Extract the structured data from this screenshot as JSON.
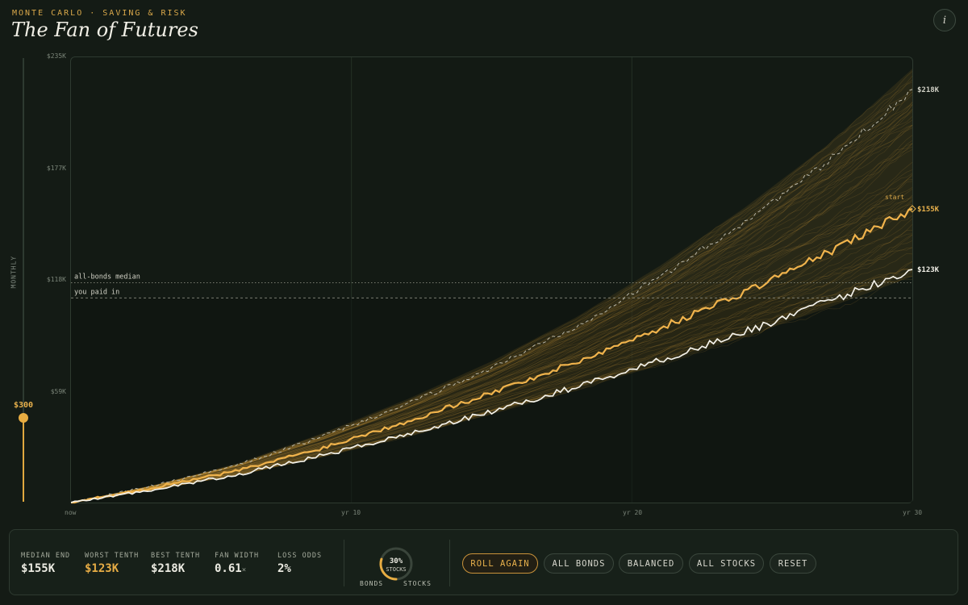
{
  "header": {
    "eyebrow": "MONTE CARLO · SAVING & RISK",
    "title": "The Fan of Futures",
    "info_label": "i"
  },
  "slider": {
    "label": "MONTHLY",
    "value_label": "$300",
    "level_fraction": 0.19
  },
  "chart_data": {
    "type": "line",
    "x_ticks": [
      "now",
      "yr 10",
      "yr 20",
      "yr 30"
    ],
    "xlim": [
      0,
      30
    ],
    "y_ticks": [
      "$235K",
      "$177K",
      "$118K",
      "$59K"
    ],
    "ylim": [
      0,
      235
    ],
    "series": [
      {
        "role": "best-tenth",
        "style": "dashed",
        "color": "#b9b7a8",
        "x": [
          0,
          3,
          6,
          9,
          12,
          15,
          18,
          21,
          24,
          27,
          30
        ],
        "y": [
          0,
          9,
          20,
          35,
          52,
          71,
          93,
          119,
          148,
          180,
          218
        ]
      },
      {
        "role": "median",
        "style": "solid",
        "color": "#f0b34c",
        "x": [
          0,
          3,
          6,
          9,
          12,
          15,
          18,
          21,
          24,
          27,
          30
        ],
        "y": [
          0,
          8,
          17,
          29,
          43,
          58,
          74,
          92,
          111,
          132,
          155
        ]
      },
      {
        "role": "worst-tenth",
        "style": "solid",
        "color": "#f4f2ea",
        "x": [
          0,
          3,
          6,
          9,
          12,
          15,
          18,
          21,
          24,
          27,
          30
        ],
        "y": [
          0,
          7,
          15,
          25,
          36,
          48,
          61,
          75,
          90,
          106,
          123
        ]
      }
    ],
    "reference_lines": [
      {
        "label": "all-bonds median",
        "y": 116
      },
      {
        "label": "you paid in",
        "y": 108
      }
    ],
    "end_labels": [
      "$218K",
      "$155K",
      "$123K"
    ],
    "start_marker_label": "start",
    "colors": {
      "accent": "#e8ad42",
      "background": "#141b15"
    }
  },
  "stats": {
    "median_end": {
      "label": "MEDIAN END",
      "value": "$155K"
    },
    "worst_tenth": {
      "label": "WORST TENTH",
      "value": "$123K"
    },
    "best_tenth": {
      "label": "BEST TENTH",
      "value": "$218K"
    },
    "fan_width": {
      "label": "FAN WIDTH",
      "value": "0.61",
      "unit": "×"
    },
    "loss_odds": {
      "label": "LOSS ODDS",
      "value": "2%"
    }
  },
  "allocation": {
    "percent": "30%",
    "percent_fraction": 0.3,
    "sub": "STOCKS",
    "left_label": "BONDS",
    "right_label": "STOCKS"
  },
  "buttons": {
    "roll": "ROLL AGAIN",
    "bonds": "ALL BONDS",
    "balanced": "BALANCED",
    "stocks": "ALL STOCKS",
    "reset": "RESET"
  }
}
